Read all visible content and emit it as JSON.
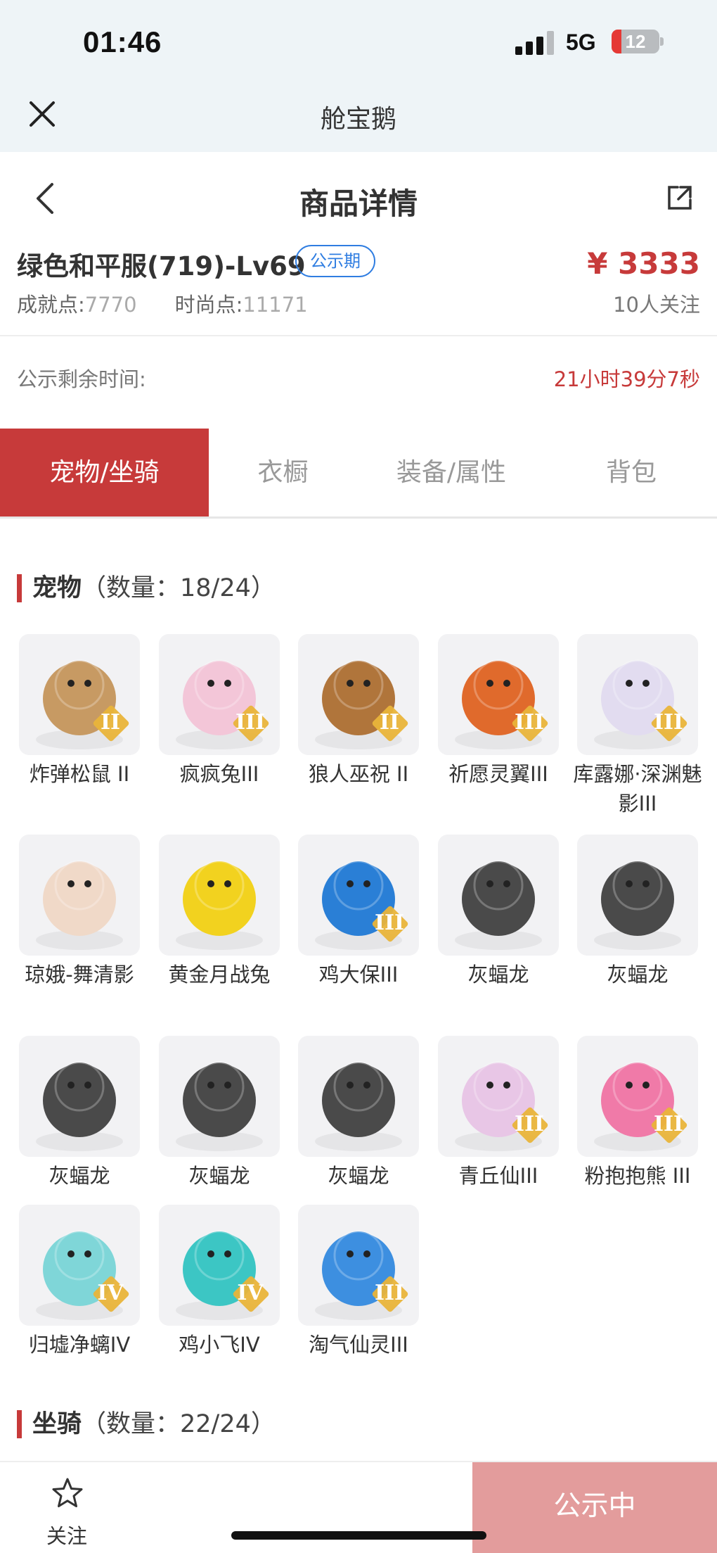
{
  "status_bar": {
    "time": "01:46",
    "network": "5G",
    "battery": "12"
  },
  "app": {
    "title": "舱宝鹅"
  },
  "header": {
    "title": "商品详情"
  },
  "item": {
    "name": "绿色和平服(719)-Lv69",
    "badge": "公示期",
    "price": "¥ 3333",
    "achievement_label": "成就点:",
    "achievement_value": "7770",
    "fashion_label": "时尚点:",
    "fashion_value": "11171",
    "followers": "10人关注",
    "remaining_label": "公示剩余时间:",
    "remaining_value": "21小时39分7秒"
  },
  "tabs": [
    {
      "label": "宠物/坐骑",
      "active": true
    },
    {
      "label": "衣橱",
      "active": false
    },
    {
      "label": "装备/属性",
      "active": false
    },
    {
      "label": "背包",
      "active": false
    }
  ],
  "pets_section": {
    "title": "宠物",
    "count": "（数量：18/24）"
  },
  "pets": [
    {
      "name": "炸弹松鼠 II",
      "rank": "II",
      "icon": "squirrel-icon",
      "color": "#c79a63"
    },
    {
      "name": "疯疯兔III",
      "rank": "III",
      "icon": "rabbit-icon",
      "color": "#f3c6d8"
    },
    {
      "name": "狼人巫祝 II",
      "rank": "II",
      "icon": "werewolf-icon",
      "color": "#b0753b"
    },
    {
      "name": "祈愿灵翼III",
      "rank": "III",
      "icon": "griffin-icon",
      "color": "#e06a2c"
    },
    {
      "name": "库露娜·深渊魅影III",
      "rank": "III",
      "icon": "fairy-icon",
      "color": "#e2dcf0"
    },
    {
      "name": "琼娥-舞清影",
      "rank": "",
      "icon": "dancer-icon",
      "color": "#f0d9c8"
    },
    {
      "name": "黄金月战兔",
      "rank": "",
      "icon": "gold-rabbit-icon",
      "color": "#f2d21f"
    },
    {
      "name": "鸡大保III",
      "rank": "III",
      "icon": "blue-bird-icon",
      "color": "#2a7fd6"
    },
    {
      "name": "灰蝠龙",
      "rank": "",
      "icon": "dragon-icon",
      "color": "#4a4a4a"
    },
    {
      "name": "灰蝠龙",
      "rank": "",
      "icon": "dragon-icon",
      "color": "#4a4a4a"
    },
    {
      "name": "灰蝠龙",
      "rank": "",
      "icon": "dragon-icon",
      "color": "#4a4a4a"
    },
    {
      "name": "灰蝠龙",
      "rank": "",
      "icon": "dragon-icon",
      "color": "#4a4a4a"
    },
    {
      "name": "灰蝠龙",
      "rank": "",
      "icon": "dragon-icon",
      "color": "#4a4a4a"
    },
    {
      "name": "青丘仙III",
      "rank": "III",
      "icon": "fox-fairy-icon",
      "color": "#e8c6e6"
    },
    {
      "name": "粉抱抱熊 III",
      "rank": "III",
      "icon": "pink-bear-icon",
      "color": "#f07aa8"
    },
    {
      "name": "归墟净螭IV",
      "rank": "IV",
      "icon": "water-dragon-icon",
      "color": "#7fd6d8"
    },
    {
      "name": "鸡小飞IV",
      "rank": "IV",
      "icon": "chick-icon",
      "color": "#3cc6c4"
    },
    {
      "name": "淘气仙灵III",
      "rank": "III",
      "icon": "puppy-icon",
      "color": "#3d8fe0"
    }
  ],
  "mounts_section": {
    "title": "坐骑",
    "count": "（数量：22/24）"
  },
  "bottom": {
    "follow_label": "关注",
    "cta_label": "公示中"
  },
  "colors": {
    "accent": "#c73a3a",
    "badge": "#2f7de1",
    "cta": "#e39c9c"
  }
}
